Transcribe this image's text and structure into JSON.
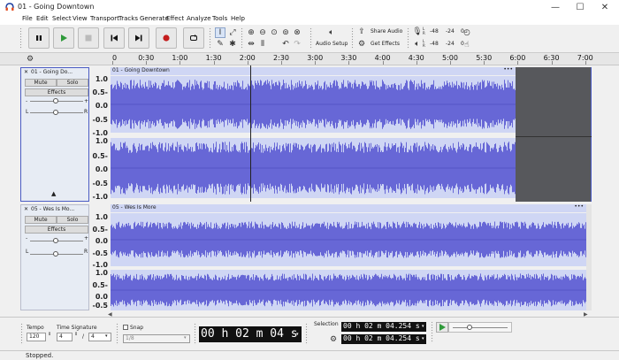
{
  "window": {
    "title": "01 - Going Downtown",
    "controls": [
      "—",
      "☐",
      "✕"
    ]
  },
  "menu": [
    "File",
    "Edit",
    "Select",
    "View",
    "Transport",
    "Tracks",
    "Generate",
    "Effect",
    "Analyze",
    "Tools",
    "Help"
  ],
  "toolbar": {
    "audio_setup_label": "Audio Setup",
    "share_audio_label": "Share Audio",
    "get_effects_label": "Get Effects",
    "meter_ticks": [
      "-48",
      "-24",
      "0"
    ],
    "meter_rec": [
      "-48",
      "-24",
      "0"
    ],
    "meter_channels": [
      "L",
      "R"
    ]
  },
  "ruler": {
    "ticks": [
      "0",
      "0:30",
      "1:00",
      "1:30",
      "2:00",
      "2:30",
      "3:00",
      "3:30",
      "4:00",
      "4:30",
      "5:00",
      "5:30",
      "6:00",
      "6:30",
      "7:00"
    ]
  },
  "tracks": [
    {
      "name": "01 - Going Do...",
      "clip_name": "01 - Going Downtown",
      "mute": "Mute",
      "solo": "Solo",
      "effects": "Effects",
      "pan_l": "L",
      "pan_r": "R",
      "gain_minus": "-",
      "gain_plus": "+",
      "scale": [
        "1.0",
        "0.5-",
        "0.0",
        "-0.5",
        "-1.0"
      ]
    },
    {
      "name": "05 - Wes Is Mo...",
      "clip_name": "05 - Wes Is More",
      "mute": "Mute",
      "solo": "Solo",
      "effects": "Effects",
      "pan_l": "L",
      "pan_r": "R",
      "gain_minus": "-",
      "gain_plus": "+",
      "scale": [
        "1.0",
        "0.5-",
        "0.0",
        "-0.5",
        "-1.0"
      ]
    }
  ],
  "selbar": {
    "tempo_label": "Tempo",
    "tempo_value": "120",
    "time_sig_label": "Time Signature",
    "time_sig_num": "4",
    "time_sig_den": "4",
    "time_sig_sep": "/",
    "snap_label": "Snap",
    "snap_value": "1/8",
    "big_time": "00 h 02 m 04 s",
    "selection_label": "Selection",
    "sel_start": "00 h 02 m 04.254 s",
    "sel_end": "00 h 02 m 04.254 s"
  },
  "status": "Stopped.",
  "colors": {
    "waveform": "#6767d6",
    "clip_bg": "#cfd6f4",
    "selected_outline": "#4b5cc4"
  }
}
